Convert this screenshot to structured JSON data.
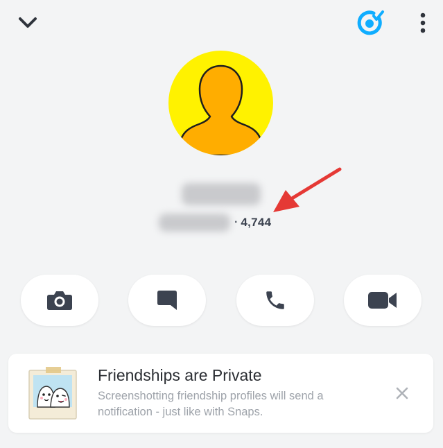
{
  "profile": {
    "friendship_score": "4,744",
    "score_separator": "·"
  },
  "header": {
    "collapse_icon": "chevron-down-icon",
    "snapstreak_icon": "target-check-icon",
    "more_icon": "kebab-menu-icon"
  },
  "actions": [
    {
      "icon": "camera-icon"
    },
    {
      "icon": "chat-bubble-icon"
    },
    {
      "icon": "phone-icon"
    },
    {
      "icon": "video-camera-icon"
    }
  ],
  "notice": {
    "title": "Friendships are Private",
    "body": "Screenshotting friendship profiles will send a notification - just like with Snaps."
  },
  "colors": {
    "background": "#f3f4f5",
    "avatar_yellow": "#fff200",
    "avatar_figure": "#ffad00",
    "accent_blue": "#0fadff",
    "annotation_red": "#e53935",
    "icon_dark": "#3c4350"
  }
}
